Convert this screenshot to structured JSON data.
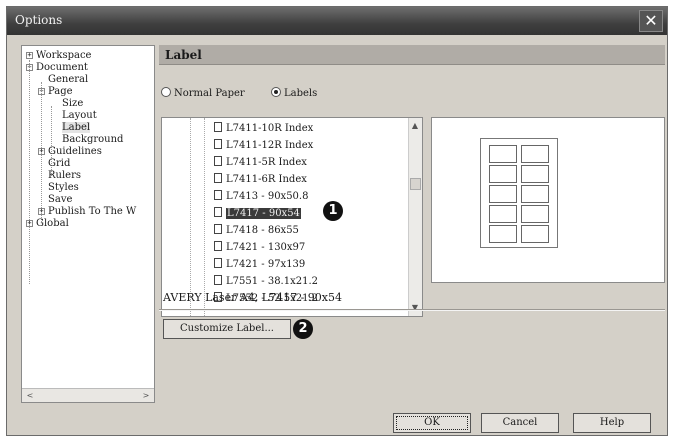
{
  "window": {
    "title": "Options",
    "close_glyph": "✕"
  },
  "tree": {
    "items": [
      {
        "label": "Workspace",
        "expander": "+"
      },
      {
        "label": "Document",
        "expander": "−"
      },
      {
        "label": "General"
      },
      {
        "label": "Page",
        "expander": "−"
      },
      {
        "label": "Size"
      },
      {
        "label": "Layout"
      },
      {
        "label": "Label"
      },
      {
        "label": "Background"
      },
      {
        "label": "Guidelines",
        "expander": "+"
      },
      {
        "label": "Grid"
      },
      {
        "label": "Rulers"
      },
      {
        "label": "Styles"
      },
      {
        "label": "Save"
      },
      {
        "label": "Publish To The W",
        "expander": "+"
      },
      {
        "label": "Global",
        "expander": "+"
      }
    ],
    "scroll_left": "<",
    "scroll_right": ">"
  },
  "panel": {
    "title": "Label",
    "radio_normal": "Normal Paper",
    "radio_labels": "Labels",
    "list_items": [
      "L7411-10R Index",
      "L7411-12R Index",
      "L7411-5R Index",
      "L7411-6R Index",
      "L7413 - 90x50.8",
      "L7417 - 90x54",
      "L7418 - 86x55",
      "L7421 - 130x97",
      "L7421 - 97x139",
      "L7551 - 38.1x21.2",
      "L7552 - 52.5x21.2"
    ],
    "selected_index": 5,
    "scroll_up": "▲",
    "scroll_down": "▼",
    "status": "AVERY Laser A4, L7417 - 90x54",
    "customize_label": "Customize Label...",
    "marker_1": "1",
    "marker_2": "2"
  },
  "footer": {
    "ok": "OK",
    "cancel": "Cancel",
    "help": "Help"
  }
}
